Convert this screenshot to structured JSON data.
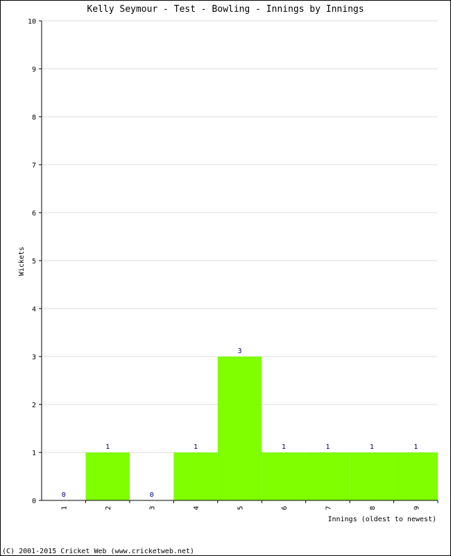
{
  "chart_data": {
    "type": "bar",
    "title": "Kelly Seymour - Test - Bowling - Innings by Innings",
    "xlabel": "Innings (oldest to newest)",
    "ylabel": "Wickets",
    "categories": [
      "1",
      "2",
      "3",
      "4",
      "5",
      "6",
      "7",
      "8",
      "9"
    ],
    "values": [
      0,
      1,
      0,
      1,
      3,
      1,
      1,
      1,
      1
    ],
    "data_labels": [
      "0",
      "1",
      "0",
      "1",
      "3",
      "1",
      "1",
      "1",
      "1"
    ],
    "ylim": [
      0,
      10
    ],
    "yticks": [
      "0",
      "1",
      "2",
      "3",
      "4",
      "5",
      "6",
      "7",
      "8",
      "9",
      "10"
    ],
    "grid": true,
    "bar_color": "#80ff00",
    "label_color": "#000080"
  },
  "footer": "(C) 2001-2015 Cricket Web (www.cricketweb.net)"
}
